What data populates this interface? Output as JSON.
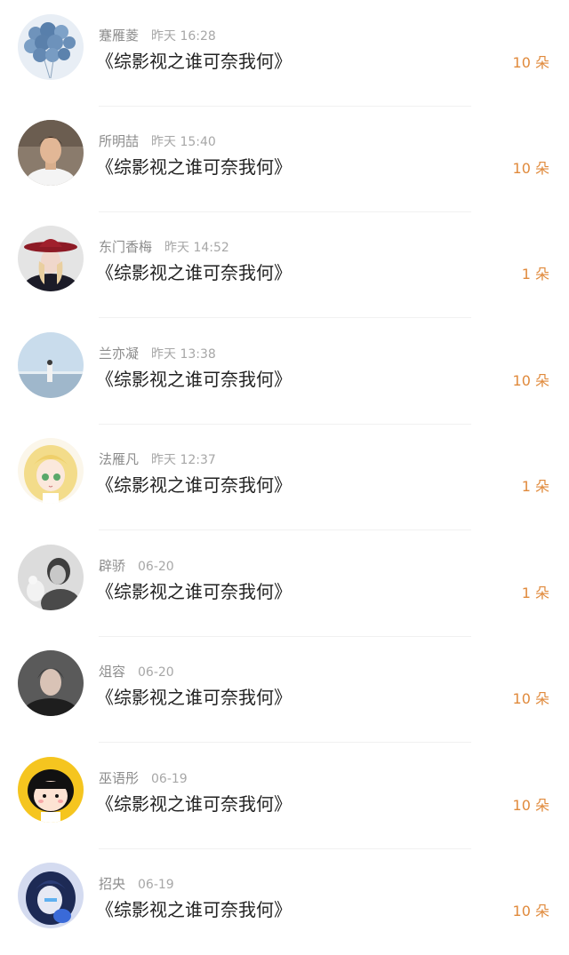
{
  "gifts": [
    {
      "name": "蹇雁菱",
      "time": "昨天 16:28",
      "title": "《综影视之谁可奈我何》",
      "amount": "10 朵",
      "avatar_color": "#7fa0c4"
    },
    {
      "name": "所明喆",
      "time": "昨天 15:40",
      "title": "《综影视之谁可奈我何》",
      "amount": "10 朵",
      "avatar_color": "#c9a88a"
    },
    {
      "name": "东门香梅",
      "time": "昨天 14:52",
      "title": "《综影视之谁可奈我何》",
      "amount": "1 朵",
      "avatar_color": "#b1333c"
    },
    {
      "name": "兰亦凝",
      "time": "昨天 13:38",
      "title": "《综影视之谁可奈我何》",
      "amount": "10 朵",
      "avatar_color": "#b7cfe3"
    },
    {
      "name": "法雁凡",
      "time": "昨天 12:37",
      "title": "《综影视之谁可奈我何》",
      "amount": "1 朵",
      "avatar_color": "#f2dc8c"
    },
    {
      "name": "辟骄",
      "time": "06-20",
      "title": "《综影视之谁可奈我何》",
      "amount": "1 朵",
      "avatar_color": "#bdbdbd"
    },
    {
      "name": "俎容",
      "time": "06-20",
      "title": "《综影视之谁可奈我何》",
      "amount": "10 朵",
      "avatar_color": "#3d3d3d"
    },
    {
      "name": "巫语彤",
      "time": "06-19",
      "title": "《综影视之谁可奈我何》",
      "amount": "10 朵",
      "avatar_color": "#f3c21c"
    },
    {
      "name": "招央",
      "time": "06-19",
      "title": "《综影视之谁可奈我何》",
      "amount": "10 朵",
      "avatar_color": "#3a4f86"
    }
  ],
  "colors": {
    "accent": "#e08a3c",
    "name": "#8c8c8c",
    "title": "#222222"
  }
}
